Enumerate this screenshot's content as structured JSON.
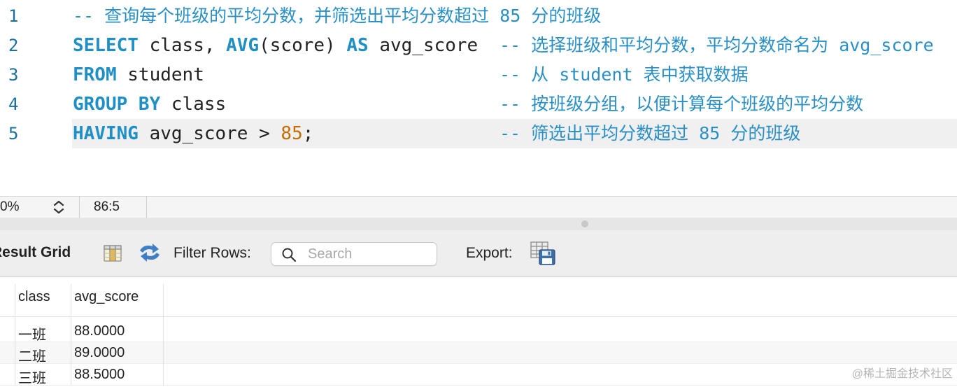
{
  "editor": {
    "lines": [
      {
        "num": "1",
        "comment": "-- 查询每个班级的平均分数，并筛选出平均分数超过 85 分的班级"
      },
      {
        "num": "2",
        "kw1": "SELECT",
        "t1": " class, ",
        "kw2": "AVG",
        "t2": "(score) ",
        "kw3": "AS",
        "t3": " avg_score",
        "comment": "-- 选择班级和平均分数，平均分数命名为 avg_score"
      },
      {
        "num": "3",
        "kw1": "FROM",
        "t1": " student",
        "comment": "-- 从 student 表中获取数据"
      },
      {
        "num": "4",
        "kw1": "GROUP BY",
        "t1": " class",
        "comment": "-- 按班级分组，以便计算每个班级的平均分数"
      },
      {
        "num": "5",
        "kw1": "HAVING",
        "t1": " avg_score > ",
        "n1": "85",
        "t2": ";",
        "comment": "-- 筛选出平均分数超过 85 分的班级"
      }
    ]
  },
  "status": {
    "zoom": "0%",
    "cursor": "86:5"
  },
  "toolbar": {
    "title": "Result Grid",
    "filter_label": "Filter Rows:",
    "search_placeholder": "Search",
    "export_label": "Export:"
  },
  "grid": {
    "columns": [
      "class",
      "avg_score"
    ],
    "rows": [
      [
        "一班",
        "88.0000"
      ],
      [
        "二班",
        "89.0000"
      ],
      [
        "三班",
        "88.5000"
      ]
    ]
  },
  "watermark": "@稀土掘金技术社区",
  "colors": {
    "keyword": "#1f8fc6",
    "comment": "#2a8fc5",
    "number": "#c46e00"
  }
}
